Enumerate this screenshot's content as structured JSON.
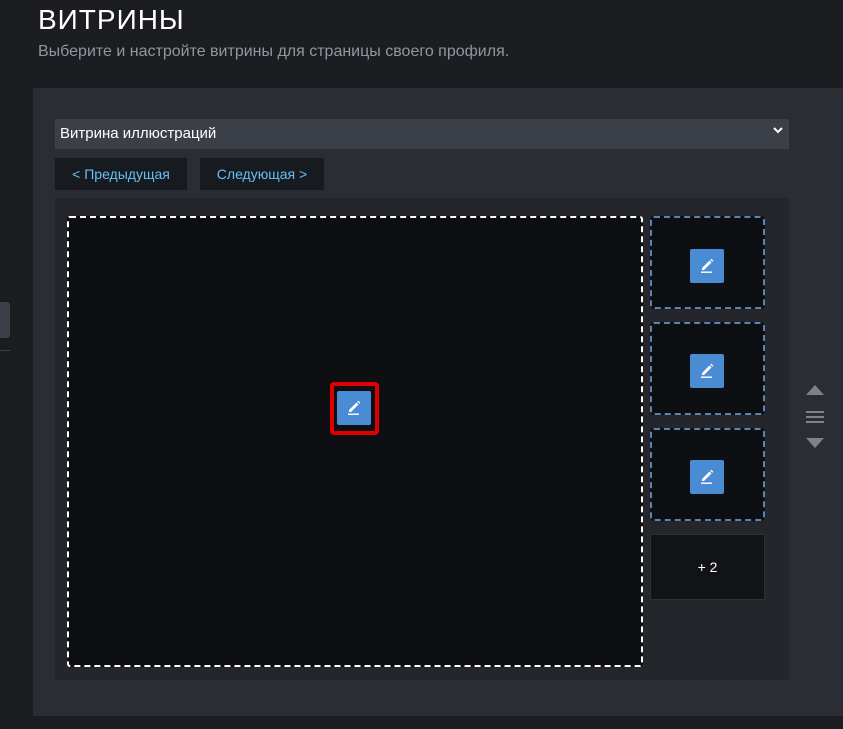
{
  "header": {
    "title": "ВИТРИНЫ",
    "subtitle": "Выберите и настройте витрины для страницы своего профиля."
  },
  "showcase_select": {
    "value": "Витрина иллюстраций",
    "icon": "chevron-down-icon"
  },
  "nav": {
    "prev_label": "< Предыдущая",
    "next_label": "Следующая >"
  },
  "slots": {
    "edit_icon": "pencil-icon",
    "more_label": "+ 2"
  },
  "colors": {
    "accent": "#66c0f4",
    "edit_button": "#4a8cd4",
    "highlight": "#e00000"
  }
}
